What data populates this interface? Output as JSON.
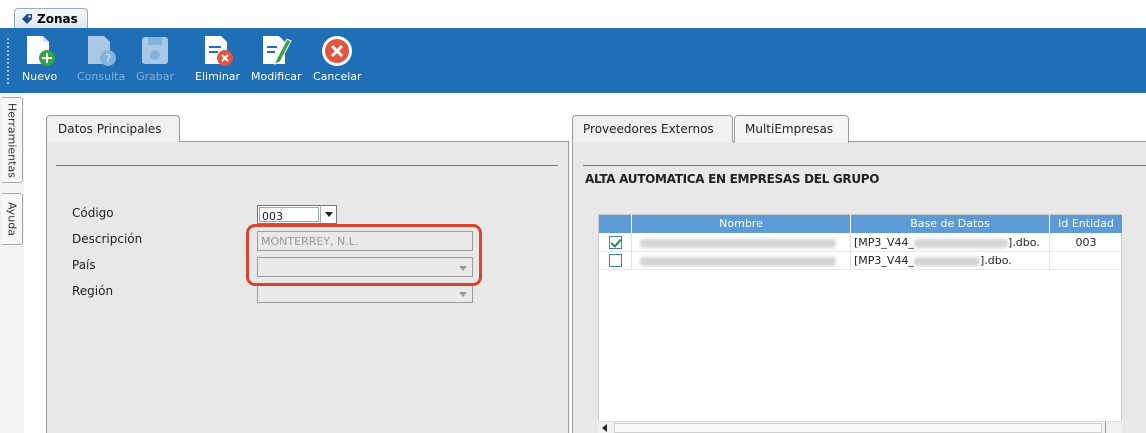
{
  "window": {
    "tab_title": "Zonas"
  },
  "toolbar": {
    "buttons": [
      {
        "id": "nuevo",
        "label": "Nuevo",
        "icon": "new-document-icon",
        "enabled": true
      },
      {
        "id": "consulta",
        "label": "Consulta",
        "icon": "query-document-icon",
        "enabled": false
      },
      {
        "id": "grabar",
        "label": "Grabar",
        "icon": "save-disk-icon",
        "enabled": false
      },
      {
        "id": "eliminar",
        "label": "Eliminar",
        "icon": "delete-document-icon",
        "enabled": true
      },
      {
        "id": "modificar",
        "label": "Modificar",
        "icon": "edit-document-icon",
        "enabled": true
      },
      {
        "id": "cancelar",
        "label": "Cancelar",
        "icon": "cancel-circle-icon",
        "enabled": true
      }
    ]
  },
  "sidebar": {
    "tabs": [
      "Herramientas",
      "Ayuda"
    ]
  },
  "left_panel": {
    "tab": "Datos Principales",
    "fields": {
      "codigo": {
        "label": "Código",
        "value": "003"
      },
      "descripcion": {
        "label": "Descripción",
        "value": "MONTERREY, N.L."
      },
      "pais": {
        "label": "País",
        "value": ""
      },
      "region": {
        "label": "Región",
        "value": ""
      }
    }
  },
  "right_panel": {
    "tabs": [
      "Proveedores Externos",
      "MultiEmpresas"
    ],
    "active_tab": "MultiEmpresas",
    "heading": "ALTA AUTOMATICA EN EMPRESAS DEL GRUPO",
    "grid": {
      "columns": [
        "Nombre",
        "Base de Datos",
        "Id Entidad"
      ],
      "rows": [
        {
          "checked": true,
          "nombre": "",
          "db_prefix": "[MP3_V44_",
          "db_suffix": "].dbo.",
          "id_entidad": "003"
        },
        {
          "checked": false,
          "nombre": "",
          "db_prefix": "[MP3_V44_",
          "db_suffix": "].dbo.",
          "id_entidad": ""
        }
      ]
    }
  },
  "colors": {
    "toolbar_bg": "#1e6fb5",
    "grid_header": "#5d9bd6",
    "highlight": "#d9432f"
  }
}
